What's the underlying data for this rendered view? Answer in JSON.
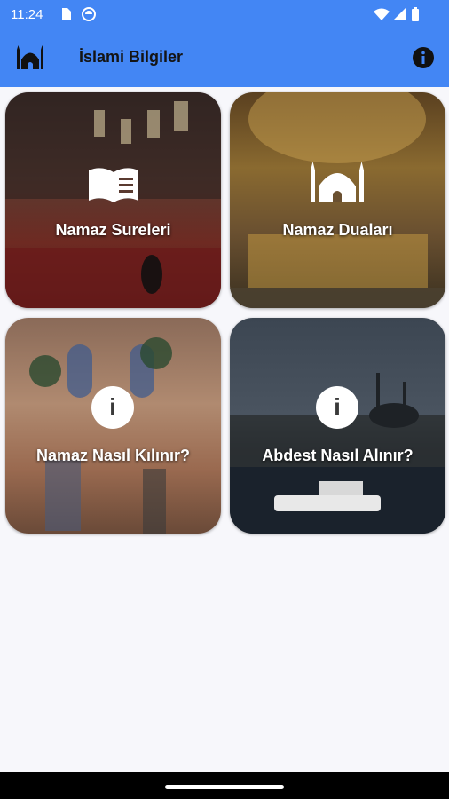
{
  "status_bar": {
    "time": "11:24"
  },
  "app_bar": {
    "title": "İslami Bilgiler",
    "logo_icon": "mosque-icon",
    "info_icon": "info-icon"
  },
  "cards": [
    {
      "label": "Namaz Sureleri",
      "icon": "book-icon"
    },
    {
      "label": "Namaz Duaları",
      "icon": "mosque-icon"
    },
    {
      "label": "Namaz Nasıl Kılınır?",
      "icon": "info-icon",
      "icon_text": "i"
    },
    {
      "label": "Abdest Nasıl Alınır?",
      "icon": "info-icon",
      "icon_text": "i"
    }
  ],
  "colors": {
    "app_bar": "#4386f4",
    "background": "#f7f7fb"
  }
}
